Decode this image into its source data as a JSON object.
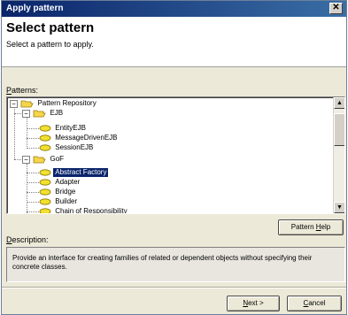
{
  "window": {
    "title": "Apply pattern",
    "close_glyph": "✕"
  },
  "header": {
    "title": "Select pattern",
    "subtitle": "Select a pattern to apply."
  },
  "patterns": {
    "label_accel": "P",
    "label_rest": "atterns:",
    "tree": [
      {
        "label": "Pattern Repository",
        "kind": "folder",
        "expander": "−"
      },
      {
        "label": "EJB",
        "kind": "folder",
        "expander": "−"
      },
      {
        "label": "EntityEJB",
        "kind": "pattern"
      },
      {
        "label": "MessageDrivenEJB",
        "kind": "pattern"
      },
      {
        "label": "SessionEJB",
        "kind": "pattern"
      },
      {
        "label": "GoF",
        "kind": "folder",
        "expander": "−"
      },
      {
        "label": "Abstract Factory",
        "kind": "pattern",
        "selected": true
      },
      {
        "label": "Adapter",
        "kind": "pattern"
      },
      {
        "label": "Bridge",
        "kind": "pattern"
      },
      {
        "label": "Builder",
        "kind": "pattern"
      },
      {
        "label": "Chain of Responsibility",
        "kind": "pattern"
      }
    ],
    "scroll_up": "▲",
    "scroll_down": "▼"
  },
  "pattern_help": {
    "label_pre": "Pattern ",
    "label_accel": "H",
    "label_post": "elp"
  },
  "description": {
    "label_accel": "D",
    "label_rest": "escription:",
    "text": "Provide an interface for creating families of related or dependent objects without specifying their concrete classes."
  },
  "buttons": {
    "next_accel": "N",
    "next_rest": "ext >",
    "cancel_accel": "C",
    "cancel_rest": "ancel"
  },
  "colors": {
    "titlebar": "#0a246a",
    "selection": "#0a246a",
    "folder": "#f5d64b",
    "pattern": "#f2e030"
  }
}
